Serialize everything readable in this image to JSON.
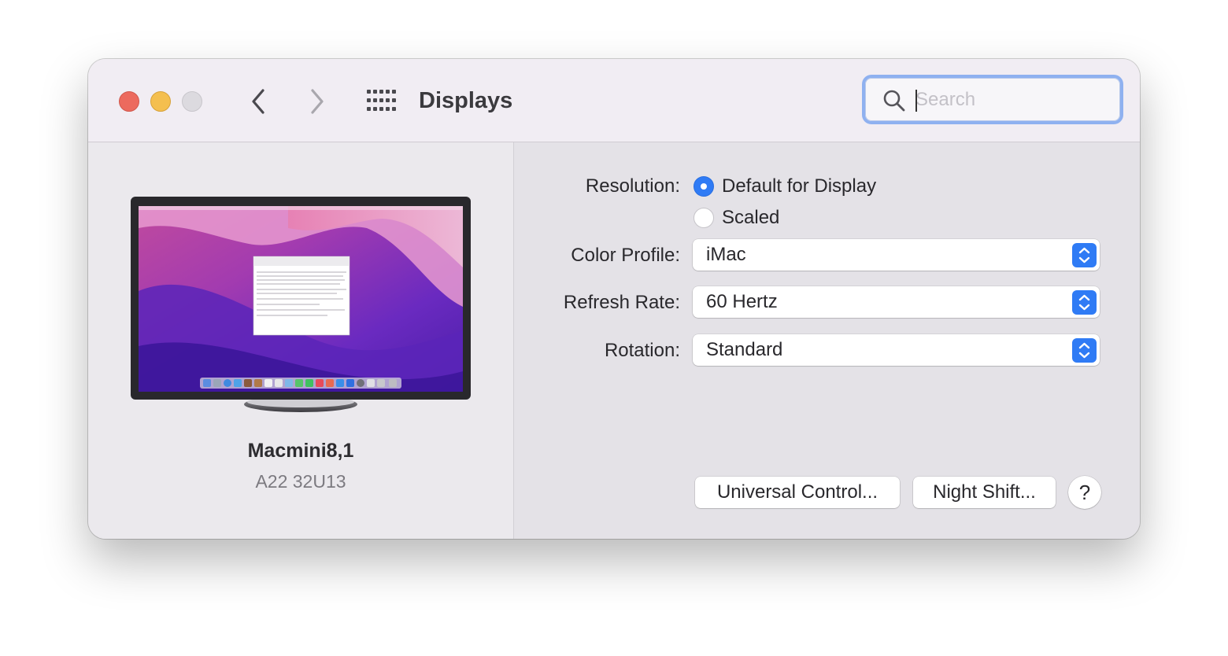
{
  "window": {
    "title": "Displays",
    "search": {
      "placeholder": "Search",
      "value": ""
    }
  },
  "display": {
    "name": "Macmini8,1",
    "model": "A22 32U13"
  },
  "settings": {
    "resolution": {
      "label": "Resolution:",
      "options": [
        {
          "label": "Default for Display",
          "selected": true
        },
        {
          "label": "Scaled",
          "selected": false
        }
      ]
    },
    "color_profile": {
      "label": "Color Profile:",
      "value": "iMac"
    },
    "refresh_rate": {
      "label": "Refresh Rate:",
      "value": "60 Hertz"
    },
    "rotation": {
      "label": "Rotation:",
      "value": "Standard"
    }
  },
  "buttons": {
    "universal_control": "Universal Control...",
    "night_shift": "Night Shift...",
    "help": "?"
  },
  "colors": {
    "accent": "#2f7bf5",
    "close": "#ec6a5e",
    "minimize": "#f4bf4f",
    "zoom_disabled": "#dcdadf",
    "search_focus_ring": "#8fb1f0"
  },
  "icons": [
    "back-chevron-icon",
    "forward-chevron-icon",
    "show-all-grid-icon",
    "search-icon",
    "popup-arrows-icon",
    "monitor-icon"
  ]
}
